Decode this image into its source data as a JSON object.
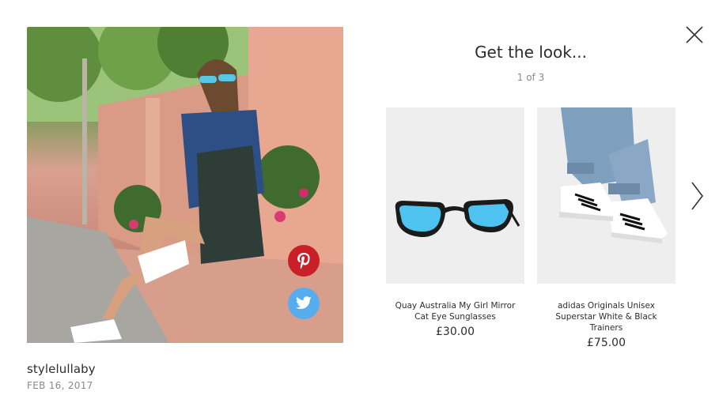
{
  "modal": {
    "close_icon": "close-icon"
  },
  "post": {
    "username": "stylelullaby",
    "date": "FEB 16, 2017",
    "share": {
      "pinterest_icon": "pinterest-icon",
      "twitter_icon": "twitter-icon",
      "pinterest_color": "#cb1f27",
      "twitter_color": "#55acee"
    }
  },
  "look": {
    "title": "Get the look...",
    "counter": "1 of 3",
    "products": [
      {
        "name": "Quay Australia My Girl Mirror Cat Eye Sunglasses",
        "price": "£30.00",
        "image_icon": "sunglasses-product-image"
      },
      {
        "name": "adidas Originals Unisex Superstar White & Black Trainers",
        "price": "£75.00",
        "image_icon": "sneakers-product-image"
      }
    ],
    "next_icon": "chevron-right-icon"
  }
}
